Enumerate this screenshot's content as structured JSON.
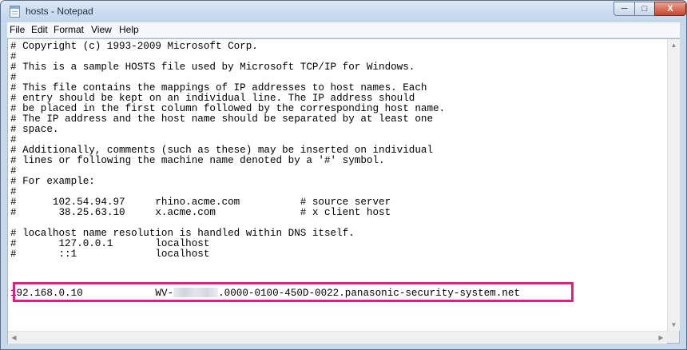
{
  "window": {
    "title": "hosts - Notepad",
    "icon": "notepad-icon",
    "controls": {
      "minimize": "minimize-icon",
      "maximize": "maximize-icon",
      "close": "close-icon",
      "close_label": "X"
    }
  },
  "menu": [
    "File",
    "Edit",
    "Format",
    "View",
    "Help"
  ],
  "content": {
    "lines": [
      "# Copyright (c) 1993-2009 Microsoft Corp.",
      "#",
      "# This is a sample HOSTS file used by Microsoft TCP/IP for Windows.",
      "#",
      "# This file contains the mappings of IP addresses to host names. Each",
      "# entry should be kept on an individual line. The IP address should",
      "# be placed in the first column followed by the corresponding host name.",
      "# The IP address and the host name should be separated by at least one",
      "# space.",
      "#",
      "# Additionally, comments (such as these) may be inserted on individual",
      "# lines or following the machine name denoted by a '#' symbol.",
      "#",
      "# For example:",
      "#",
      "#      102.54.94.97     rhino.acme.com          # source server",
      "#       38.25.63.10     x.acme.com              # x client host",
      "",
      "# localhost name resolution is handled within DNS itself.",
      "#       127.0.0.1       localhost",
      "#       ::1             localhost"
    ],
    "added_entry": {
      "ip": "192.168.0.10",
      "host_prefix": "WV-",
      "host_suffix": ".0000-0100-450D-0022.panasonic-security-system.net"
    }
  },
  "colors": {
    "highlight": "#e31d84",
    "titlebar": "#c9d9ec",
    "close_button": "#c7452b"
  },
  "scrollbars": {
    "up": "scroll-up-arrow-icon",
    "down": "scroll-down-arrow-icon",
    "left": "scroll-left-arrow-icon",
    "right": "scroll-right-arrow-icon"
  }
}
